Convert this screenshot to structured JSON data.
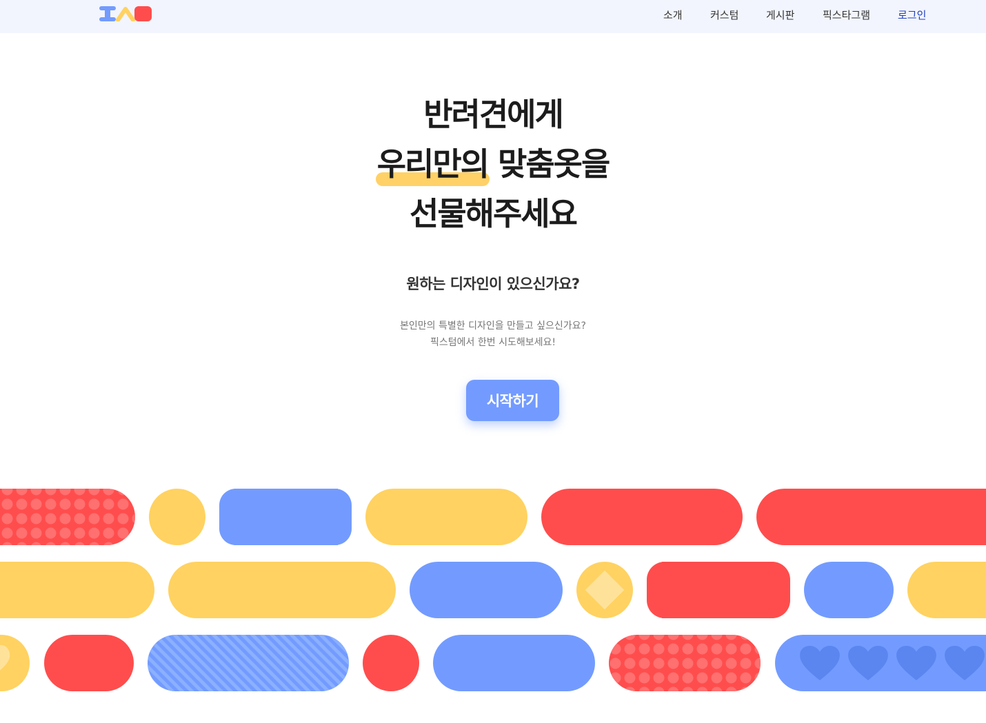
{
  "header": {
    "logo_name": "logo-icon",
    "nav": [
      {
        "label": "소개"
      },
      {
        "label": "커스텀"
      },
      {
        "label": "게시판"
      },
      {
        "label": "픽스타그램"
      },
      {
        "label": "로그인"
      }
    ]
  },
  "hero": {
    "line1": "반려견에게",
    "line2_highlight": "우리만의",
    "line2_rest": " 맞춤옷을",
    "line3": "선물해주세요"
  },
  "subtitle": "원하는 디자인이 있으신가요?",
  "description": {
    "line1": "본인만의 특별한 디자인을 만들고 싶으신가요?",
    "line2": "픽스텀에서 한번 시도해보세요!"
  },
  "cta": {
    "label": "시작하기"
  },
  "colors": {
    "red": "#ff4d4d",
    "yellow": "#ffd261",
    "blue": "#739bff",
    "header_bg": "#f2f5fd"
  }
}
